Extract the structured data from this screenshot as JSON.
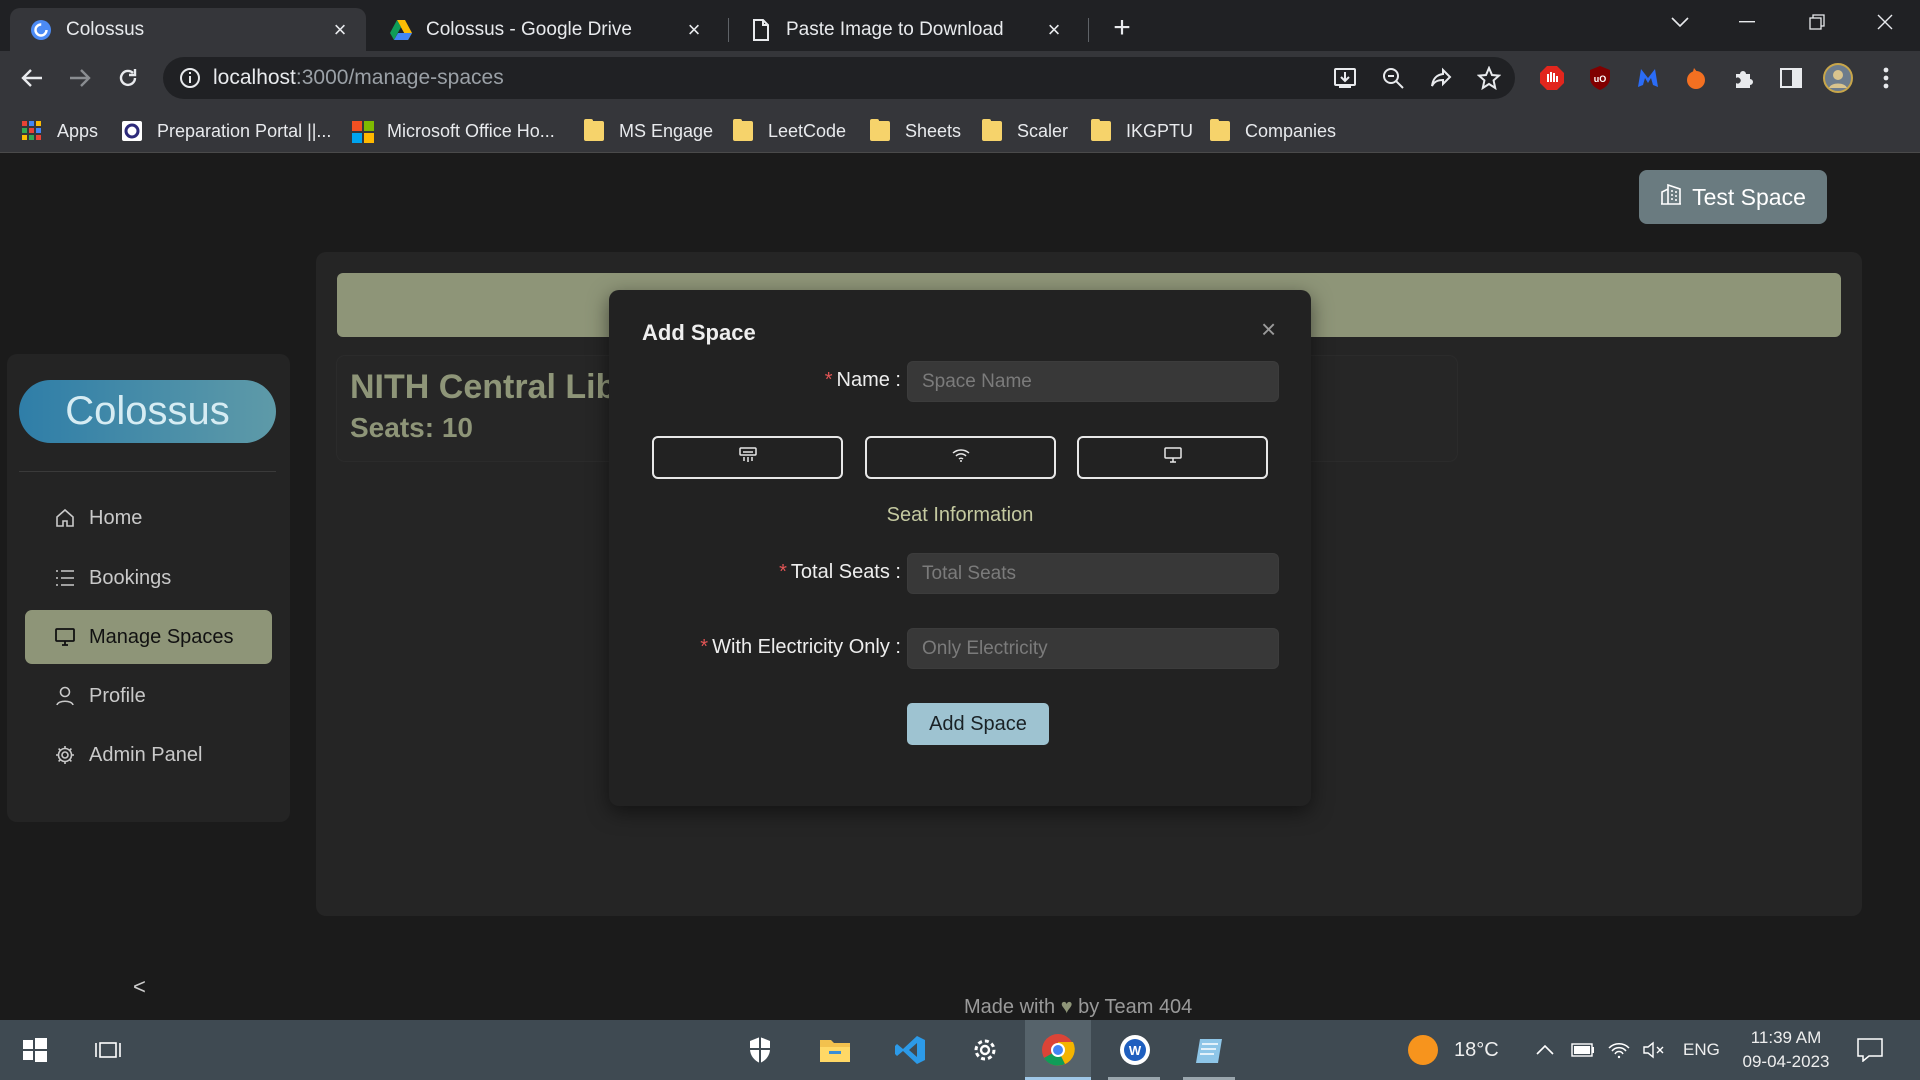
{
  "tabs": [
    {
      "title": "Colossus",
      "active": true
    },
    {
      "title": "Colossus - Google Drive",
      "active": false
    },
    {
      "title": "Paste Image to Download",
      "active": false
    }
  ],
  "address_bar": {
    "host": "localhost",
    "path": ":3000/manage-spaces"
  },
  "bookmarks": [
    {
      "label": "Apps",
      "icon": "apps-grid-icon"
    },
    {
      "label": "Preparation Portal ||...",
      "icon": "portal-icon"
    },
    {
      "label": "Microsoft Office Ho...",
      "icon": "microsoft-icon"
    },
    {
      "label": "MS Engage",
      "icon": "folder-icon"
    },
    {
      "label": "LeetCode",
      "icon": "folder-icon"
    },
    {
      "label": "Sheets",
      "icon": "folder-icon"
    },
    {
      "label": "Scaler",
      "icon": "folder-icon"
    },
    {
      "label": "IKGPTU",
      "icon": "folder-icon"
    },
    {
      "label": "Companies",
      "icon": "folder-icon"
    }
  ],
  "header": {
    "space_button": "Test Space"
  },
  "sidebar": {
    "logo": "Colossus",
    "items": [
      {
        "label": "Home",
        "icon": "home-icon",
        "active": false
      },
      {
        "label": "Bookings",
        "icon": "list-icon",
        "active": false
      },
      {
        "label": "Manage Spaces",
        "icon": "monitor-icon",
        "active": true
      },
      {
        "label": "Profile",
        "icon": "user-icon",
        "active": false
      },
      {
        "label": "Admin Panel",
        "icon": "gear-icon",
        "active": false
      }
    ],
    "collapse_glyph": "<"
  },
  "space_card": {
    "name": "NITH Central Lib",
    "seats": "Seats: 10"
  },
  "modal": {
    "title": "Add Space",
    "close_glyph": "×",
    "name_label": "Name",
    "name_placeholder": "Space Name",
    "amenities": [
      "ac-icon",
      "wifi-icon",
      "monitor-icon"
    ],
    "section_title": "Seat Information",
    "total_seats_label": "Total Seats",
    "total_seats_placeholder": "Total Seats",
    "electricity_label": "With Electricity Only",
    "electricity_placeholder": "Only Electricity",
    "submit_label": "Add Space"
  },
  "footer": {
    "text_before": "Made with",
    "text_after": "by Team 404"
  },
  "taskbar": {
    "weather_temp": "18°C",
    "language": "ENG",
    "time": "11:39 AM",
    "date": "09-04-2023"
  },
  "colors": {
    "accent_olive": "#8e9578",
    "logo_blue": "#2f7ea8",
    "submit_blue": "#9ec3d1",
    "required_red": "#e25555"
  }
}
